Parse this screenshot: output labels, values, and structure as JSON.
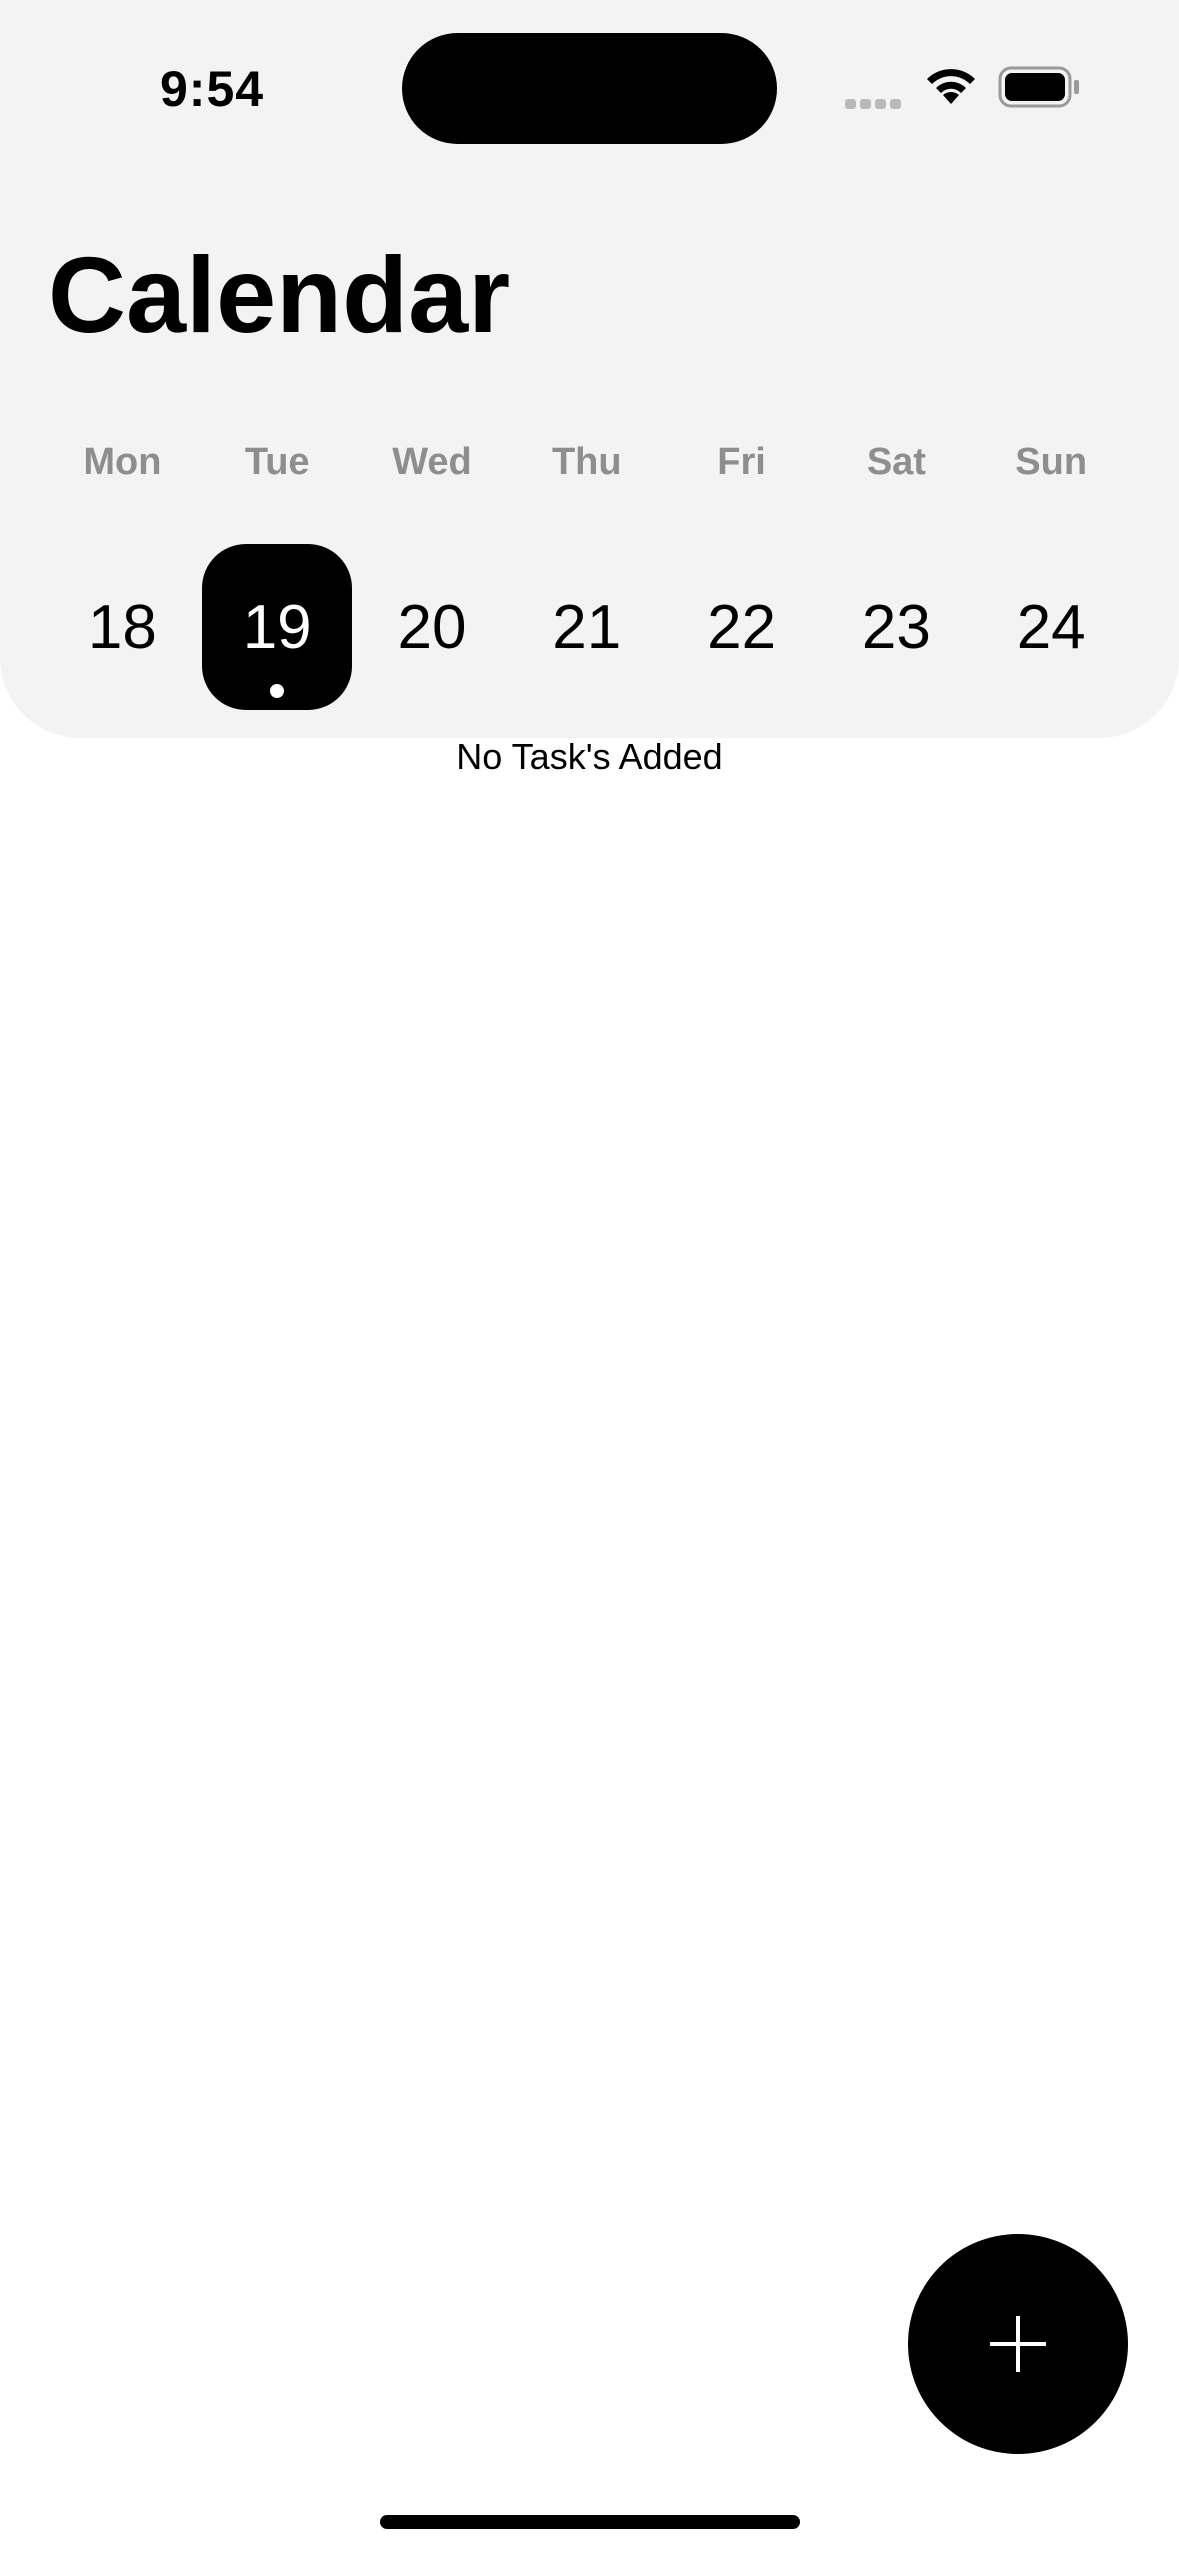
{
  "status_bar": {
    "time": "9:54",
    "icons": [
      "cellular-signal-icon",
      "wifi-icon",
      "battery-icon"
    ]
  },
  "header": {
    "title": "Calendar"
  },
  "week": {
    "days": [
      {
        "name": "Mon",
        "number": "18",
        "selected": false
      },
      {
        "name": "Tue",
        "number": "19",
        "selected": true,
        "has_indicator": true
      },
      {
        "name": "Wed",
        "number": "20",
        "selected": false
      },
      {
        "name": "Thu",
        "number": "21",
        "selected": false
      },
      {
        "name": "Fri",
        "number": "22",
        "selected": false
      },
      {
        "name": "Sat",
        "number": "23",
        "selected": false
      },
      {
        "name": "Sun",
        "number": "24",
        "selected": false
      }
    ]
  },
  "tasks": {
    "empty_message": "No Task's Added"
  },
  "fab": {
    "icon": "plus-icon"
  },
  "colors": {
    "header_background": "#f3f3f3",
    "selected_day_background": "#000000",
    "day_name_text": "#8e8e8e",
    "fab_background": "#000000"
  }
}
